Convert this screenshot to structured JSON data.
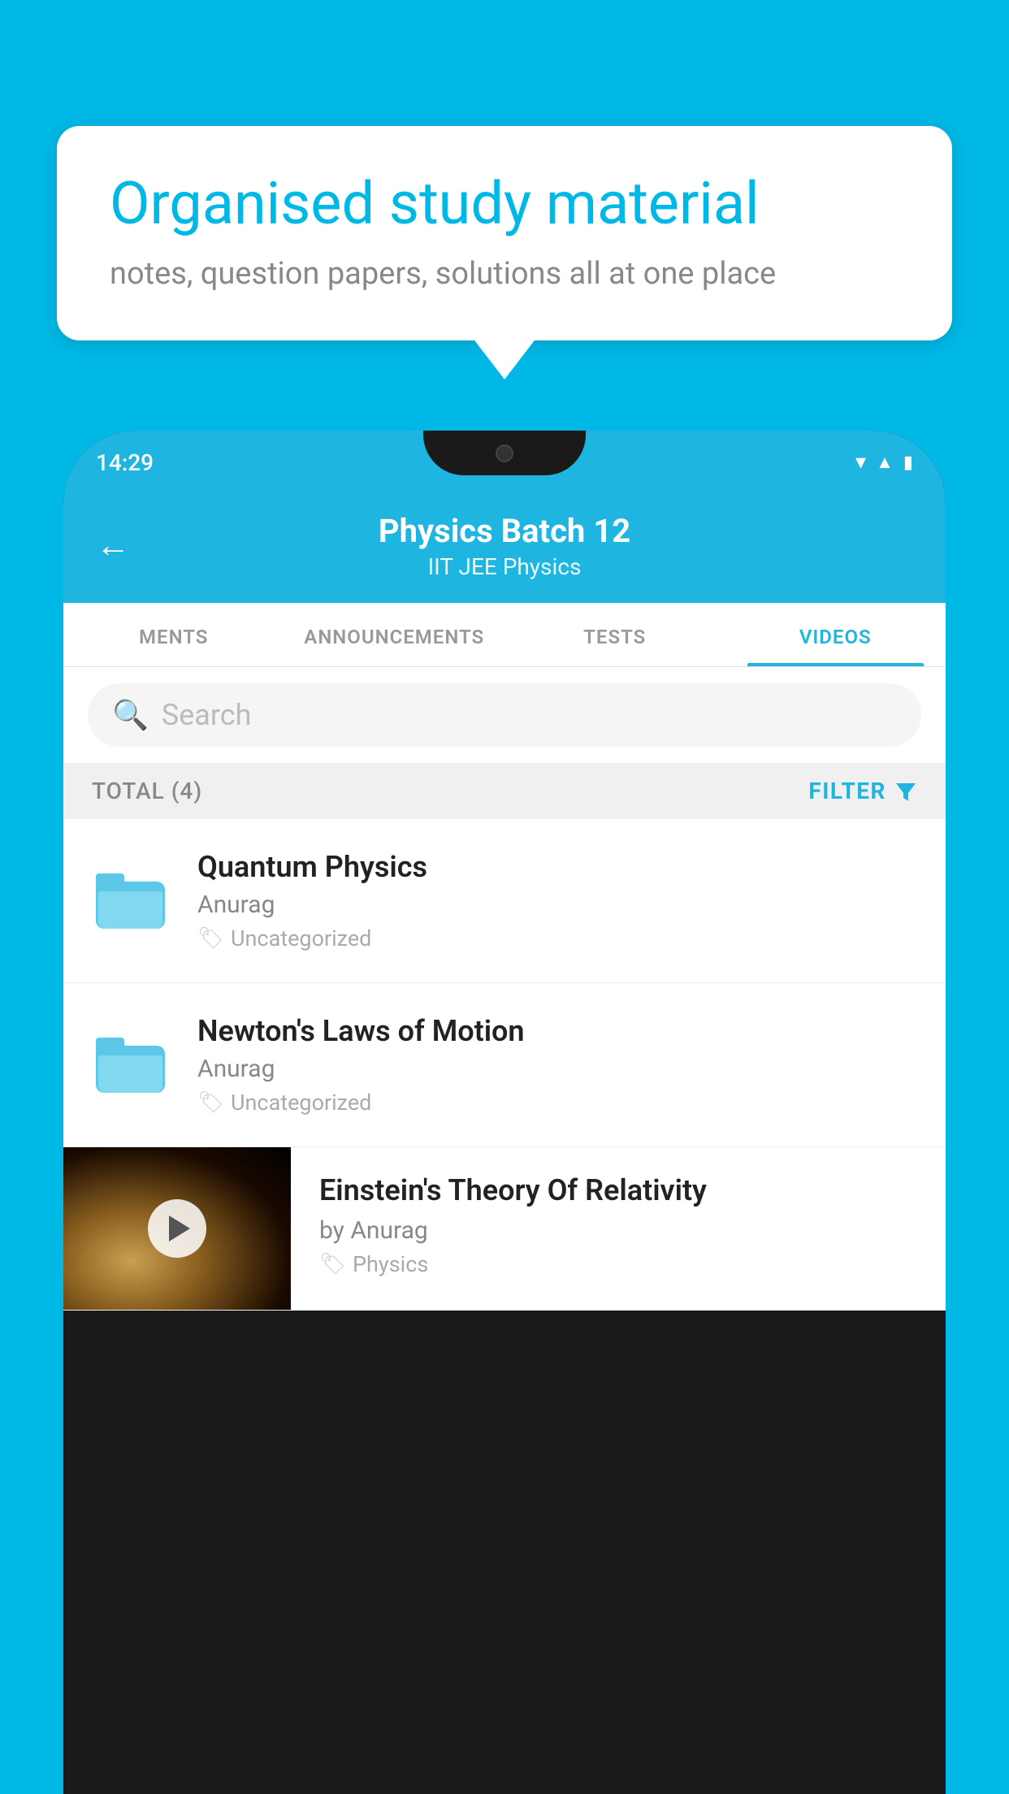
{
  "background": {
    "color": "#00b8e6"
  },
  "speech_bubble": {
    "title": "Organised study material",
    "subtitle": "notes, question papers, solutions all at one place"
  },
  "status_bar": {
    "time": "14:29",
    "icons": [
      "wifi",
      "signal",
      "battery"
    ]
  },
  "app_header": {
    "back_label": "←",
    "title": "Physics Batch 12",
    "subtitle": "IIT JEE   Physics"
  },
  "tabs": [
    {
      "label": "MENTS",
      "active": false
    },
    {
      "label": "ANNOUNCEMENTS",
      "active": false
    },
    {
      "label": "TESTS",
      "active": false
    },
    {
      "label": "VIDEOS",
      "active": true
    }
  ],
  "search": {
    "placeholder": "Search"
  },
  "filter_bar": {
    "total_label": "TOTAL (4)",
    "filter_label": "FILTER"
  },
  "videos": [
    {
      "title": "Quantum Physics",
      "author": "Anurag",
      "tag": "Uncategorized",
      "type": "folder"
    },
    {
      "title": "Newton's Laws of Motion",
      "author": "Anurag",
      "tag": "Uncategorized",
      "type": "folder"
    },
    {
      "title": "Einstein's Theory Of Relativity",
      "author": "by Anurag",
      "tag": "Physics",
      "type": "video"
    }
  ]
}
